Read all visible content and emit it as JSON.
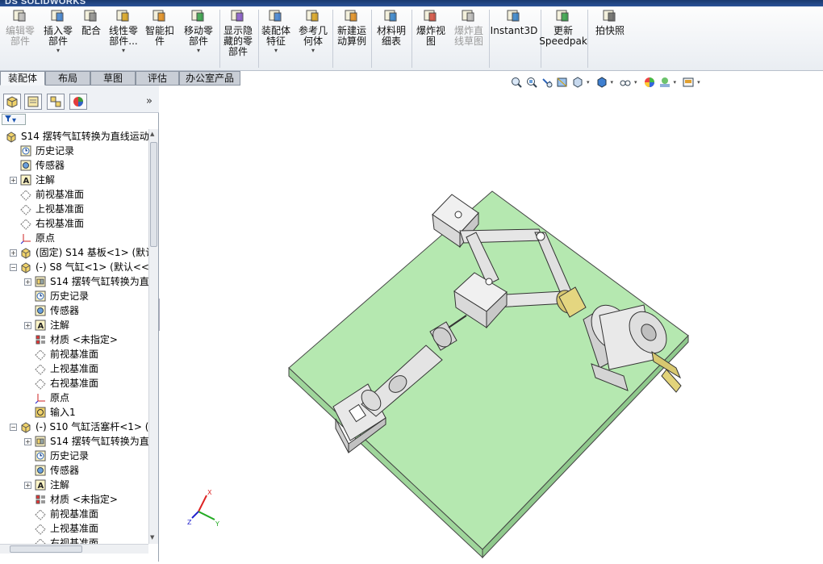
{
  "app": {
    "brand": "SOLIDWORKS",
    "brand_prefix": "DS"
  },
  "ribbon": {
    "buttons": [
      {
        "label": "编辑零\n部件",
        "icon": "edit-component-icon",
        "disabled": true
      },
      {
        "label": "插入零\n部件",
        "icon": "insert-component-icon",
        "dropdown": true
      },
      {
        "label": "配合",
        "icon": "mate-icon"
      },
      {
        "label": "线性零\n部件...",
        "icon": "linear-pattern-icon",
        "dropdown": true
      },
      {
        "label": "智能扣\n件",
        "icon": "smart-fasteners-icon"
      },
      {
        "label": "移动零\n部件",
        "icon": "move-component-icon",
        "dropdown": true
      },
      {
        "label": "显示隐\n藏的零\n部件",
        "icon": "show-hidden-icon"
      },
      {
        "label": "装配体\n特征",
        "icon": "assembly-features-icon",
        "dropdown": true
      },
      {
        "label": "参考几\n何体",
        "icon": "reference-geometry-icon",
        "dropdown": true
      },
      {
        "label": "新建运\n动算例",
        "icon": "motion-study-icon"
      },
      {
        "label": "材料明\n细表",
        "icon": "bom-icon"
      },
      {
        "label": "爆炸视\n图",
        "icon": "exploded-view-icon"
      },
      {
        "label": "爆炸直\n线草图",
        "icon": "explode-line-sketch-icon",
        "disabled": true
      },
      {
        "label": "Instant3D",
        "icon": "instant3d-icon"
      },
      {
        "label": "更新\nSpeedpak",
        "icon": "speedpak-icon"
      },
      {
        "label": "拍快照",
        "icon": "snapshot-icon"
      }
    ]
  },
  "tabs": [
    "装配体",
    "布局",
    "草图",
    "评估",
    "办公室产品"
  ],
  "tree": {
    "root": "S14 摆转气缸转换为直线运动",
    "items": [
      {
        "label": "历史记录",
        "icon": "history-icon",
        "indent": 1
      },
      {
        "label": "传感器",
        "icon": "sensor-icon",
        "indent": 1
      },
      {
        "label": "注解",
        "icon": "annotation-icon",
        "indent": 1,
        "expand": true
      },
      {
        "label": "前视基准面",
        "icon": "plane-icon",
        "indent": 1
      },
      {
        "label": "上视基准面",
        "icon": "plane-icon",
        "indent": 1
      },
      {
        "label": "右视基准面",
        "icon": "plane-icon",
        "indent": 1
      },
      {
        "label": "原点",
        "icon": "origin-icon",
        "indent": 1
      },
      {
        "label": "(固定) S14 基板<1> (默认",
        "icon": "part-icon",
        "indent": 1,
        "expand": true
      },
      {
        "label": "(-) S8 气缸<1> (默认<<默",
        "icon": "part-icon",
        "indent": 1,
        "expand": true,
        "open": true
      },
      {
        "label": "S14 摆转气缸转换为直",
        "icon": "mates-icon",
        "indent": 2,
        "expand": true
      },
      {
        "label": "历史记录",
        "icon": "history-icon",
        "indent": 2
      },
      {
        "label": "传感器",
        "icon": "sensor-icon",
        "indent": 2
      },
      {
        "label": "注解",
        "icon": "annotation-icon",
        "indent": 2,
        "expand": true
      },
      {
        "label": "材质 <未指定>",
        "icon": "material-icon",
        "indent": 2
      },
      {
        "label": "前视基准面",
        "icon": "plane-icon",
        "indent": 2
      },
      {
        "label": "上视基准面",
        "icon": "plane-icon",
        "indent": 2
      },
      {
        "label": "右视基准面",
        "icon": "plane-icon",
        "indent": 2
      },
      {
        "label": "原点",
        "icon": "origin-icon",
        "indent": 2
      },
      {
        "label": "输入1",
        "icon": "import-icon",
        "indent": 2
      },
      {
        "label": "(-) S10 气缸活塞杆<1> (默",
        "icon": "part-icon",
        "indent": 1,
        "expand": true,
        "open": true
      },
      {
        "label": "S14 摆转气缸转换为直",
        "icon": "mates-icon",
        "indent": 2,
        "expand": true
      },
      {
        "label": "历史记录",
        "icon": "history-icon",
        "indent": 2
      },
      {
        "label": "传感器",
        "icon": "sensor-icon",
        "indent": 2
      },
      {
        "label": "注解",
        "icon": "annotation-icon",
        "indent": 2,
        "expand": true
      },
      {
        "label": "材质 <未指定>",
        "icon": "material-icon",
        "indent": 2
      },
      {
        "label": "前视基准面",
        "icon": "plane-icon",
        "indent": 2
      },
      {
        "label": "上视基准面",
        "icon": "plane-icon",
        "indent": 2
      },
      {
        "label": "右视基准面",
        "icon": "plane-icon",
        "indent": 2
      }
    ]
  },
  "triad": {
    "x": "X",
    "y": "Y",
    "z": "Z"
  },
  "colors": {
    "base_plate": "#b5e8b0",
    "part_grey": "#d9d9d9",
    "brass": "#d8c870",
    "accent": "#1a52b0"
  }
}
